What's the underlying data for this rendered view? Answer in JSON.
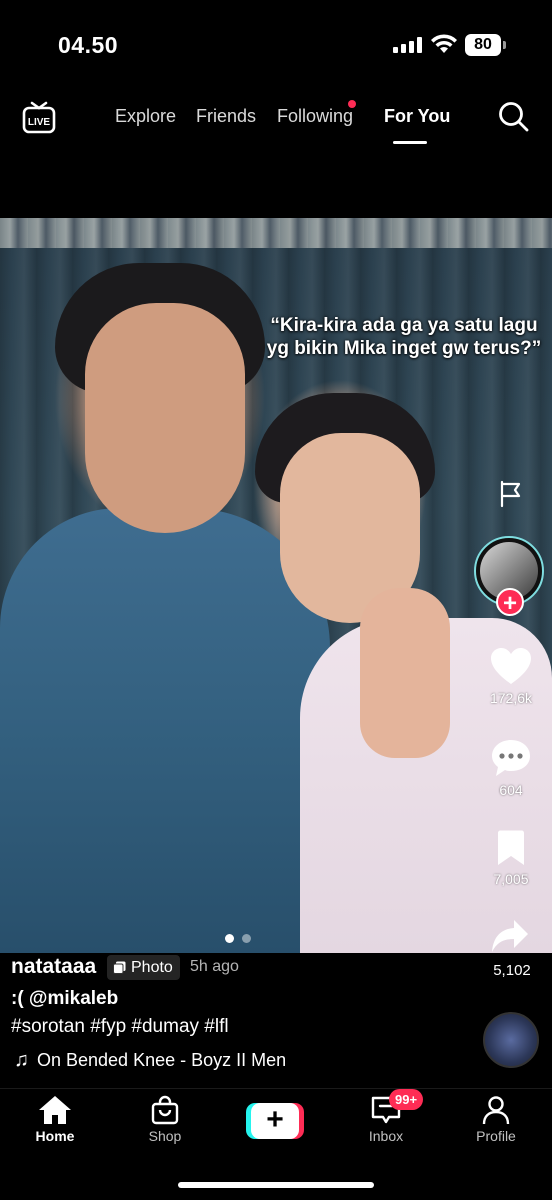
{
  "status_bar": {
    "time": "04.50",
    "battery": "80"
  },
  "top_nav": {
    "tabs": [
      {
        "label": "Explore"
      },
      {
        "label": "Friends"
      },
      {
        "label": "Following"
      },
      {
        "label": "For You"
      }
    ],
    "active_tab": "For You"
  },
  "post": {
    "overlay_text": "“Kira-kira ada ga ya satu lagu yg bikin Mika inget gw terus?”",
    "username": "natataaa",
    "type_badge": "Photo",
    "time_ago": "5h ago",
    "caption": ":( @mikaleb",
    "hashtags": "#sorotan #fyp #dumay #lfl",
    "music": "On Bended Knee - Boyz II Men",
    "likes": "172,6k",
    "comments": "604",
    "saves": "7,005",
    "shares": "5,102",
    "photo_count": 2,
    "current_photo": 1
  },
  "tab_bar": {
    "home": "Home",
    "shop": "Shop",
    "inbox": "Inbox",
    "inbox_badge": "99+",
    "profile": "Profile"
  },
  "colors": {
    "accent": "#fe2c55",
    "cyan": "#25f4ee",
    "background": "#000000"
  }
}
